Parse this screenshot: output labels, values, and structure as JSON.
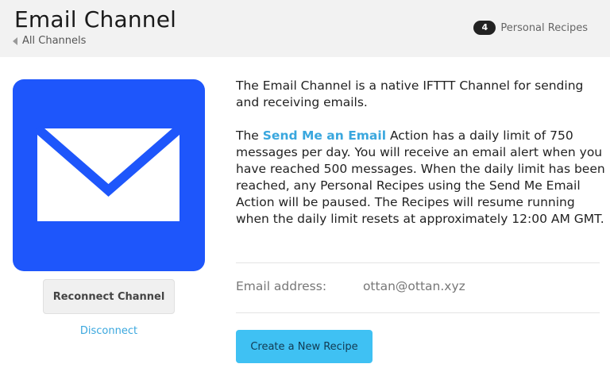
{
  "header": {
    "title": "Email Channel",
    "back_label": "All Channels",
    "recipe_count": "4",
    "recipe_label": "Personal Recipes"
  },
  "logo": {
    "icon": "envelope-icon",
    "background": "#1e56fb"
  },
  "actions": {
    "reconnect_label": "Reconnect Channel",
    "disconnect_label": "Disconnect",
    "create_label": "Create a New Recipe"
  },
  "description": {
    "intro": "The Email Channel is a native IFTTT Channel for sending and receiving emails.",
    "limit_prefix": "The ",
    "action_link": "Send Me an Email",
    "limit_text": " Action has a daily limit of 750 messages per day. You will receive an email alert when you have reached 500 messages. When the daily limit has been reached, any Personal Recipes using the Send Me Email Action will be paused. The Recipes will resume running when the daily limit resets at approximately 12:00 AM GMT."
  },
  "account": {
    "label": "Email address:",
    "value": "ottan@ottan.xyz"
  },
  "colors": {
    "accent": "#3fc1f3",
    "link": "#3aa7de"
  }
}
